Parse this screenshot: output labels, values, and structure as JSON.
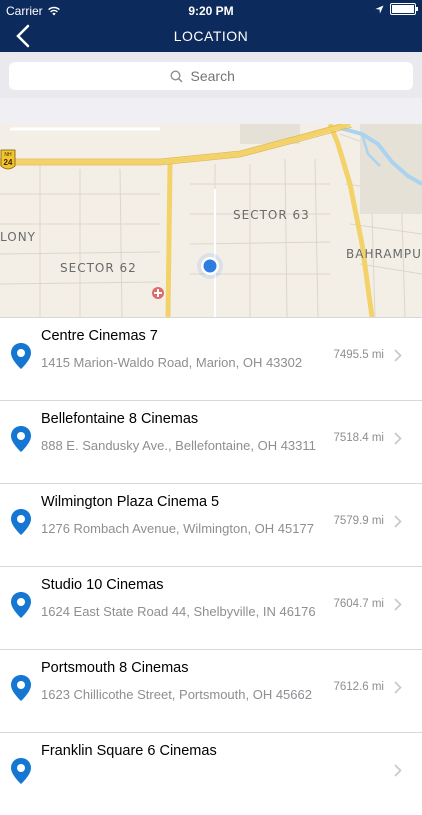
{
  "status": {
    "carrier": "Carrier",
    "time": "9:20 PM"
  },
  "nav": {
    "title": "LOCATION"
  },
  "search": {
    "placeholder": "Search"
  },
  "map": {
    "labels": [
      "SECTOR 63",
      "SECTOR 62",
      "LONY",
      "BAHRAMPU"
    ],
    "highway_shield": {
      "top": "NH",
      "number": "24"
    }
  },
  "cinemas": [
    {
      "name": "Centre Cinemas 7",
      "address": "1415 Marion-Waldo Road, Marion, OH 43302",
      "distance": "7495.5 mi"
    },
    {
      "name": "Bellefontaine 8 Cinemas",
      "address": "888 E. Sandusky Ave., Bellefontaine, OH 43311",
      "distance": "7518.4 mi"
    },
    {
      "name": "Wilmington Plaza Cinema 5",
      "address": "1276 Rombach Avenue, Wilmington, OH 45177",
      "distance": "7579.9 mi"
    },
    {
      "name": "Studio 10 Cinemas",
      "address": "1624 East State Road 44, Shelbyville, IN 46176",
      "distance": "7604.7 mi"
    },
    {
      "name": "Portsmouth 8 Cinemas",
      "address": "1623 Chillicothe Street, Portsmouth, OH 45662",
      "distance": "7612.6 mi"
    },
    {
      "name": "Franklin Square 6 Cinemas",
      "address": "",
      "distance": ""
    }
  ],
  "colors": {
    "header": "#0d2a5c",
    "pin": "#1677d2",
    "location_dot": "#2f7de1"
  }
}
